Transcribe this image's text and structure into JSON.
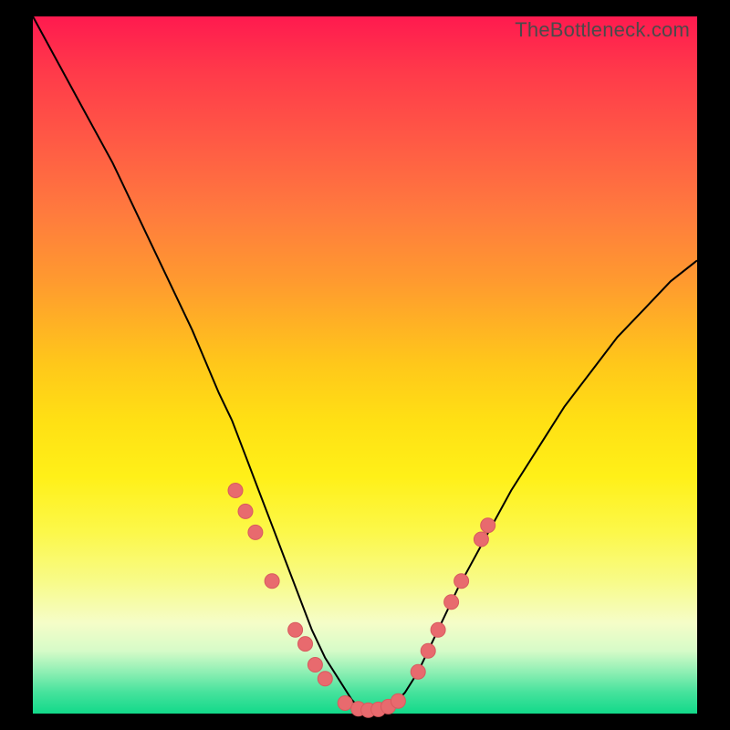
{
  "watermark": "TheBottleneck.com",
  "colors": {
    "frame": "#000000",
    "curve": "#000000",
    "dot_fill": "#e86a6e",
    "dot_stroke": "#d85a5e",
    "gradient_top": "#ff1a4f",
    "gradient_bottom": "#12d98a"
  },
  "chart_data": {
    "type": "line",
    "title": "",
    "xlabel": "",
    "ylabel": "",
    "x_range": [
      0,
      100
    ],
    "y_range": [
      0,
      100
    ],
    "series": [
      {
        "name": "bottleneck-curve",
        "x": [
          0,
          4,
          8,
          12,
          16,
          20,
          24,
          28,
          30,
          32,
          34,
          36,
          38,
          40,
          42,
          44,
          46,
          48,
          49,
          50,
          52,
          54,
          56,
          58,
          60,
          64,
          68,
          72,
          76,
          80,
          84,
          88,
          92,
          96,
          100
        ],
        "y": [
          100,
          93,
          86,
          79,
          71,
          63,
          55,
          46,
          42,
          37,
          32,
          27,
          22,
          17,
          12,
          8,
          5,
          2,
          1,
          0,
          0,
          1,
          3,
          6,
          10,
          18,
          25,
          32,
          38,
          44,
          49,
          54,
          58,
          62,
          65
        ]
      }
    ],
    "markers": [
      {
        "x": 30.5,
        "y": 32
      },
      {
        "x": 32.0,
        "y": 29
      },
      {
        "x": 33.5,
        "y": 26
      },
      {
        "x": 36.0,
        "y": 19
      },
      {
        "x": 39.5,
        "y": 12
      },
      {
        "x": 41.0,
        "y": 10
      },
      {
        "x": 42.5,
        "y": 7
      },
      {
        "x": 44.0,
        "y": 5
      },
      {
        "x": 47.0,
        "y": 1.5
      },
      {
        "x": 49.0,
        "y": 0.7
      },
      {
        "x": 50.5,
        "y": 0.5
      },
      {
        "x": 52.0,
        "y": 0.6
      },
      {
        "x": 53.5,
        "y": 1.0
      },
      {
        "x": 55.0,
        "y": 1.8
      },
      {
        "x": 58.0,
        "y": 6
      },
      {
        "x": 59.5,
        "y": 9
      },
      {
        "x": 61.0,
        "y": 12
      },
      {
        "x": 63.0,
        "y": 16
      },
      {
        "x": 64.5,
        "y": 19
      },
      {
        "x": 67.5,
        "y": 25
      },
      {
        "x": 68.5,
        "y": 27
      }
    ]
  }
}
